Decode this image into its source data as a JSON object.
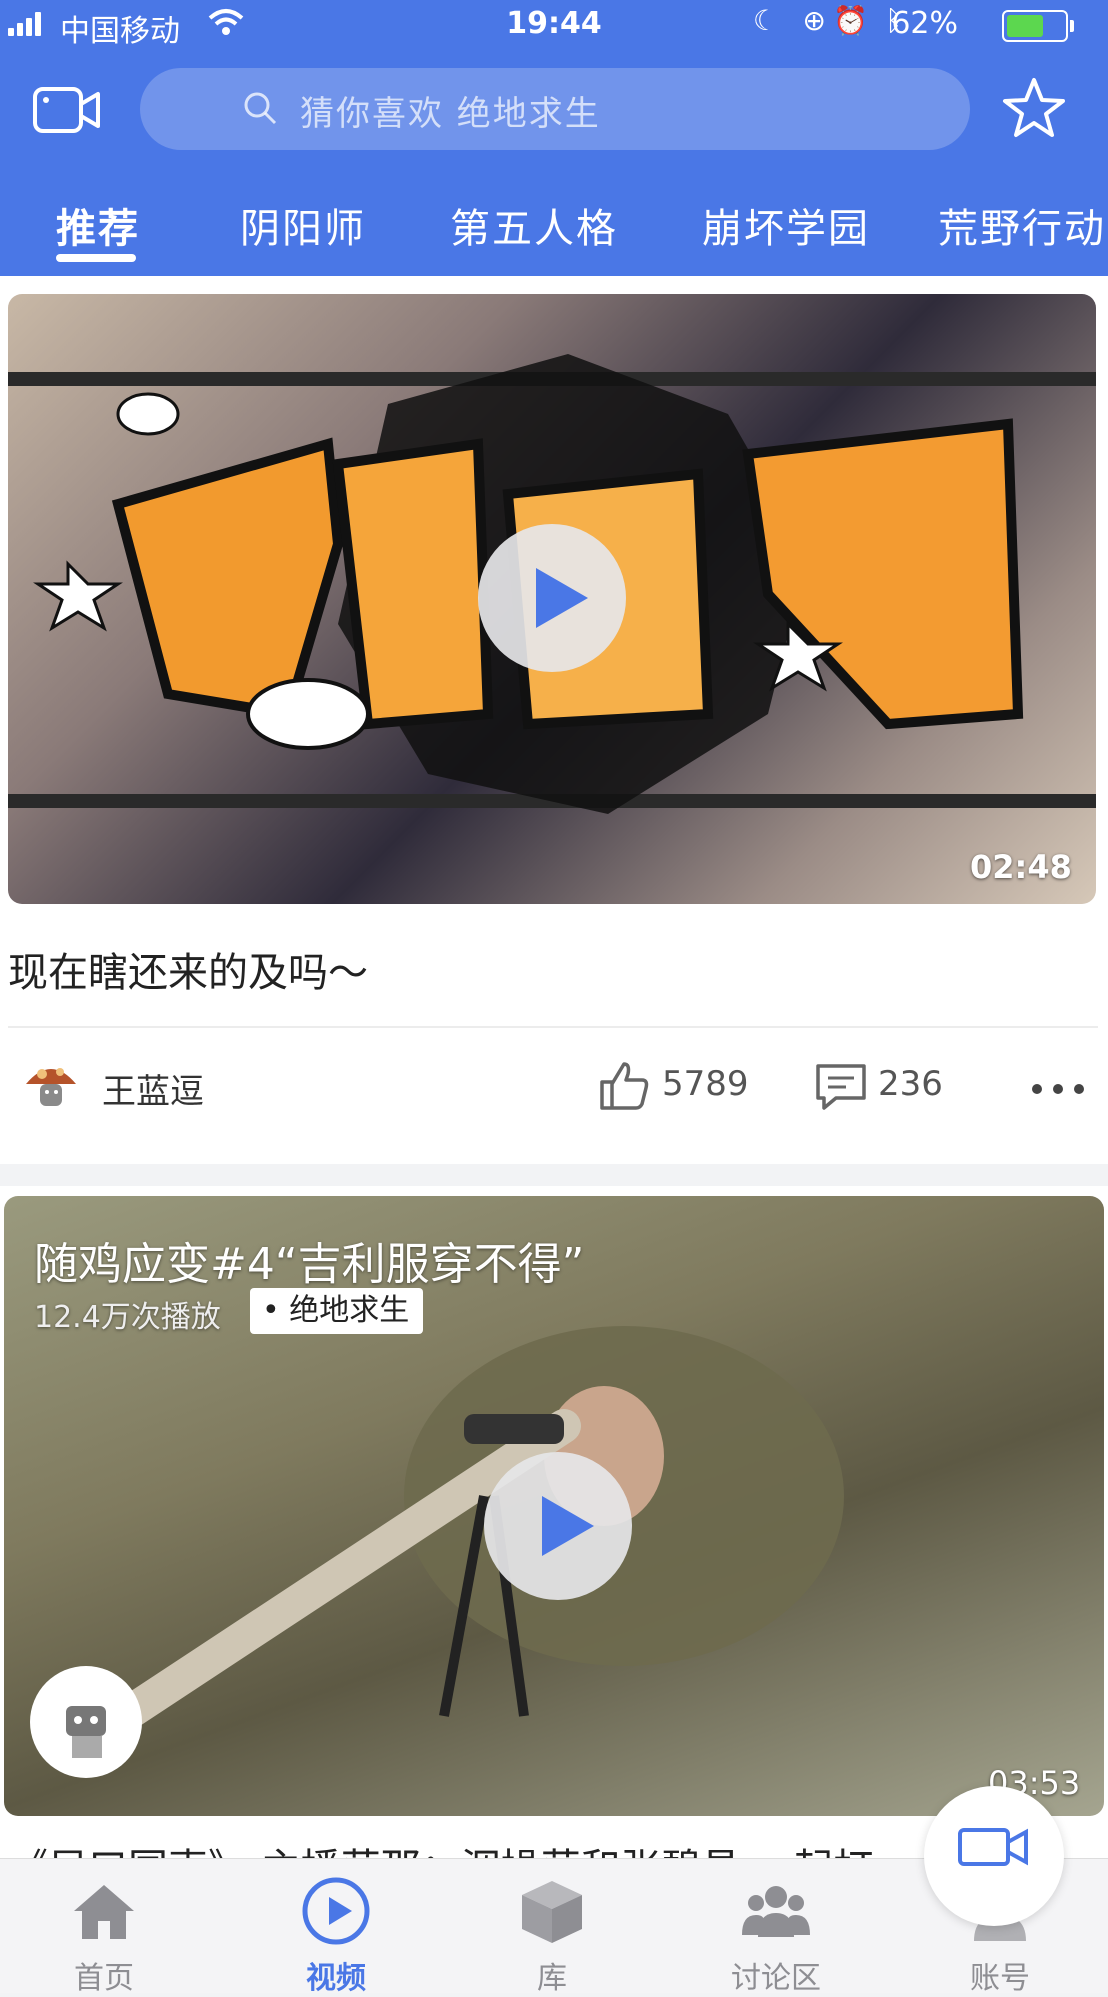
{
  "status_bar": {
    "carrier": "中国移动",
    "time": "19:44",
    "battery": "62%"
  },
  "search": {
    "placeholder": "猜你喜欢  绝地求生"
  },
  "tabs": [
    {
      "label": "推荐",
      "active": true
    },
    {
      "label": "阴阳师"
    },
    {
      "label": "第五人格"
    },
    {
      "label": "崩坏学园"
    },
    {
      "label": "荒野行动"
    }
  ],
  "cards": [
    {
      "duration": "02:48",
      "title": "现在瞎还来的及吗～",
      "author": "王蓝逗",
      "likes": "5789",
      "comments": "236"
    },
    {
      "title": "随鸡应变#4“吉利服穿不得”",
      "plays": "12.4万次播放",
      "tag": "绝地求生",
      "duration": "03:53",
      "caption": "《局口国声》 主播获那：泅操获和张碧昌 一起打"
    }
  ],
  "tabbar": [
    {
      "label": "首页",
      "icon": "home-icon"
    },
    {
      "label": "视频",
      "icon": "play-circle-icon",
      "active": true
    },
    {
      "label": "库",
      "icon": "box-icon"
    },
    {
      "label": "讨论区",
      "icon": "group-icon"
    },
    {
      "label": "账号",
      "icon": "person-icon"
    }
  ],
  "colors": {
    "brand": "#4a77e6",
    "battery": "#5cd74f"
  }
}
